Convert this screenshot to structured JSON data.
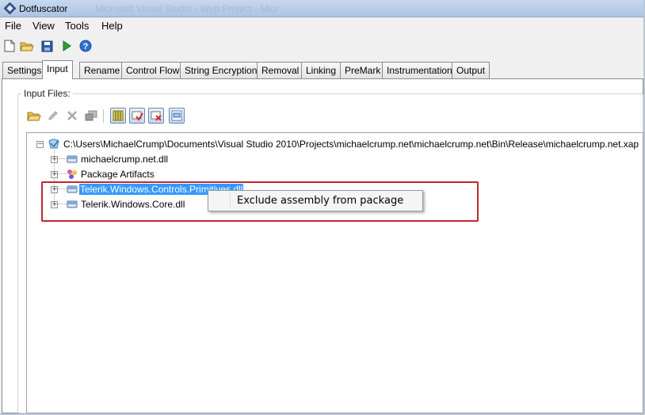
{
  "window": {
    "title": "Dotfuscator",
    "background_title": "Microsoft Visual Studio - Web Project - Micr"
  },
  "menu": [
    "File",
    "View",
    "Tools",
    "Help"
  ],
  "toolbar": [
    "new-file-icon",
    "open-folder-icon",
    "save-icon",
    "run-icon",
    "help-icon"
  ],
  "tabs": [
    "Settings",
    "Input",
    "Rename",
    "Control Flow",
    "String Encryption",
    "Removal",
    "Linking",
    "PreMark",
    "Instrumentation",
    "Output"
  ],
  "active_tab": "Input",
  "input_files": {
    "label": "Input Files:",
    "toolbar": [
      "open-folder-icon",
      "edit-icon",
      "delete-icon",
      "properties-icon",
      "library-icon",
      "exclude-icon",
      "remove-exclude-icon",
      "view-icon"
    ]
  },
  "tree": {
    "root": "C:\\Users\\MichaelCrump\\Documents\\Visual Studio 2010\\Projects\\michaelcrump.net\\michaelcrump.net\\Bin\\Release\\michaelcrump.net.xap",
    "children": [
      "michaelcrump.net.dll",
      "Package Artifacts",
      "Telerik.Windows.Controls.Primitives.dll",
      "Telerik.Windows.Core.dll"
    ]
  },
  "context_menu": {
    "item": "Exclude assembly from package"
  },
  "colors": {
    "selection": "#3399ff",
    "highlight_border": "#c0282d",
    "titlebar": "#b9cde8"
  }
}
